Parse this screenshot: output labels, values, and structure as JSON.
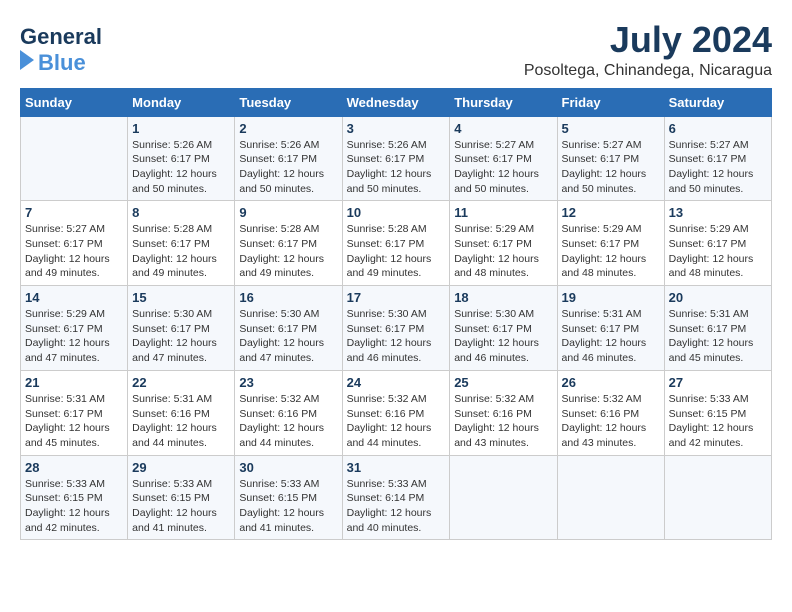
{
  "header": {
    "logo_general": "General",
    "logo_blue": "Blue",
    "month_year": "July 2024",
    "location": "Posoltega, Chinandega, Nicaragua"
  },
  "days_of_week": [
    "Sunday",
    "Monday",
    "Tuesday",
    "Wednesday",
    "Thursday",
    "Friday",
    "Saturday"
  ],
  "weeks": [
    [
      {
        "day": "",
        "info": ""
      },
      {
        "day": "1",
        "info": "Sunrise: 5:26 AM\nSunset: 6:17 PM\nDaylight: 12 hours\nand 50 minutes."
      },
      {
        "day": "2",
        "info": "Sunrise: 5:26 AM\nSunset: 6:17 PM\nDaylight: 12 hours\nand 50 minutes."
      },
      {
        "day": "3",
        "info": "Sunrise: 5:26 AM\nSunset: 6:17 PM\nDaylight: 12 hours\nand 50 minutes."
      },
      {
        "day": "4",
        "info": "Sunrise: 5:27 AM\nSunset: 6:17 PM\nDaylight: 12 hours\nand 50 minutes."
      },
      {
        "day": "5",
        "info": "Sunrise: 5:27 AM\nSunset: 6:17 PM\nDaylight: 12 hours\nand 50 minutes."
      },
      {
        "day": "6",
        "info": "Sunrise: 5:27 AM\nSunset: 6:17 PM\nDaylight: 12 hours\nand 50 minutes."
      }
    ],
    [
      {
        "day": "7",
        "info": "Sunrise: 5:27 AM\nSunset: 6:17 PM\nDaylight: 12 hours\nand 49 minutes."
      },
      {
        "day": "8",
        "info": "Sunrise: 5:28 AM\nSunset: 6:17 PM\nDaylight: 12 hours\nand 49 minutes."
      },
      {
        "day": "9",
        "info": "Sunrise: 5:28 AM\nSunset: 6:17 PM\nDaylight: 12 hours\nand 49 minutes."
      },
      {
        "day": "10",
        "info": "Sunrise: 5:28 AM\nSunset: 6:17 PM\nDaylight: 12 hours\nand 49 minutes."
      },
      {
        "day": "11",
        "info": "Sunrise: 5:29 AM\nSunset: 6:17 PM\nDaylight: 12 hours\nand 48 minutes."
      },
      {
        "day": "12",
        "info": "Sunrise: 5:29 AM\nSunset: 6:17 PM\nDaylight: 12 hours\nand 48 minutes."
      },
      {
        "day": "13",
        "info": "Sunrise: 5:29 AM\nSunset: 6:17 PM\nDaylight: 12 hours\nand 48 minutes."
      }
    ],
    [
      {
        "day": "14",
        "info": "Sunrise: 5:29 AM\nSunset: 6:17 PM\nDaylight: 12 hours\nand 47 minutes."
      },
      {
        "day": "15",
        "info": "Sunrise: 5:30 AM\nSunset: 6:17 PM\nDaylight: 12 hours\nand 47 minutes."
      },
      {
        "day": "16",
        "info": "Sunrise: 5:30 AM\nSunset: 6:17 PM\nDaylight: 12 hours\nand 47 minutes."
      },
      {
        "day": "17",
        "info": "Sunrise: 5:30 AM\nSunset: 6:17 PM\nDaylight: 12 hours\nand 46 minutes."
      },
      {
        "day": "18",
        "info": "Sunrise: 5:30 AM\nSunset: 6:17 PM\nDaylight: 12 hours\nand 46 minutes."
      },
      {
        "day": "19",
        "info": "Sunrise: 5:31 AM\nSunset: 6:17 PM\nDaylight: 12 hours\nand 46 minutes."
      },
      {
        "day": "20",
        "info": "Sunrise: 5:31 AM\nSunset: 6:17 PM\nDaylight: 12 hours\nand 45 minutes."
      }
    ],
    [
      {
        "day": "21",
        "info": "Sunrise: 5:31 AM\nSunset: 6:17 PM\nDaylight: 12 hours\nand 45 minutes."
      },
      {
        "day": "22",
        "info": "Sunrise: 5:31 AM\nSunset: 6:16 PM\nDaylight: 12 hours\nand 44 minutes."
      },
      {
        "day": "23",
        "info": "Sunrise: 5:32 AM\nSunset: 6:16 PM\nDaylight: 12 hours\nand 44 minutes."
      },
      {
        "day": "24",
        "info": "Sunrise: 5:32 AM\nSunset: 6:16 PM\nDaylight: 12 hours\nand 44 minutes."
      },
      {
        "day": "25",
        "info": "Sunrise: 5:32 AM\nSunset: 6:16 PM\nDaylight: 12 hours\nand 43 minutes."
      },
      {
        "day": "26",
        "info": "Sunrise: 5:32 AM\nSunset: 6:16 PM\nDaylight: 12 hours\nand 43 minutes."
      },
      {
        "day": "27",
        "info": "Sunrise: 5:33 AM\nSunset: 6:15 PM\nDaylight: 12 hours\nand 42 minutes."
      }
    ],
    [
      {
        "day": "28",
        "info": "Sunrise: 5:33 AM\nSunset: 6:15 PM\nDaylight: 12 hours\nand 42 minutes."
      },
      {
        "day": "29",
        "info": "Sunrise: 5:33 AM\nSunset: 6:15 PM\nDaylight: 12 hours\nand 41 minutes."
      },
      {
        "day": "30",
        "info": "Sunrise: 5:33 AM\nSunset: 6:15 PM\nDaylight: 12 hours\nand 41 minutes."
      },
      {
        "day": "31",
        "info": "Sunrise: 5:33 AM\nSunset: 6:14 PM\nDaylight: 12 hours\nand 40 minutes."
      },
      {
        "day": "",
        "info": ""
      },
      {
        "day": "",
        "info": ""
      },
      {
        "day": "",
        "info": ""
      }
    ]
  ]
}
